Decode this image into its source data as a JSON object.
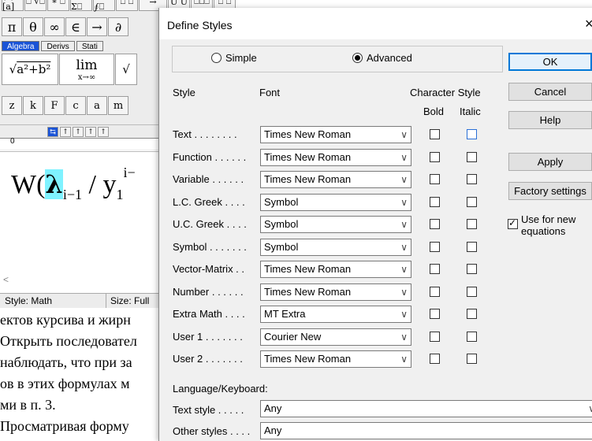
{
  "background": {
    "toolbar_row1": [
      "(a) [a]",
      "⎕ √⎕",
      "∗ ⎕",
      "Σ⎕ Σ⎕",
      "∫⎕ ∮⎕",
      "⎕ ⎕",
      "→",
      "Ū Ů",
      "⎕⎕⎕",
      "⎕ ⎕"
    ],
    "toolbar_row2": [
      "π",
      "θ",
      "∞",
      "∈",
      "→",
      "∂"
    ],
    "tabs": [
      "Algebra",
      "Derivs",
      "Stati"
    ],
    "toolbar_row4": [
      "z",
      "k",
      "F",
      "c",
      "a",
      "m"
    ],
    "tab_stops": [
      "↹",
      "↑",
      "↑",
      "↑",
      "↑"
    ],
    "ruler_zero": "0",
    "equation": {
      "W": "W(",
      "lambda": "λ",
      "sub": "i−1",
      "slash": " / ",
      "y": "y",
      "y_sub": "1",
      "sup": "i−"
    },
    "status_style": "Style: Math",
    "status_size": "Size: Full",
    "doc_lines": [
      "ектов курсива и жирн",
      "Открыть последовател",
      "наблюдать, что при за",
      "ов в этих формулах м",
      "ми в п. 3.",
      "Просматривая форму"
    ]
  },
  "dialog": {
    "title": "Define Styles",
    "close": "×",
    "mode_simple": "Simple",
    "mode_advanced": "Advanced",
    "col_style": "Style",
    "col_font": "Font",
    "col_charstyle": "Character Style",
    "col_bold": "Bold",
    "col_italic": "Italic",
    "rows": [
      {
        "style": "Text . . . . . . . .",
        "font": "Times New Roman",
        "bold": false,
        "italic": false
      },
      {
        "style": "Function . . . . . .",
        "font": "Times New Roman",
        "bold": false,
        "italic": false
      },
      {
        "style": "Variable . . . . . .",
        "font": "Times New Roman",
        "bold": false,
        "italic": false
      },
      {
        "style": "L.C. Greek . . . .",
        "font": "Symbol",
        "bold": false,
        "italic": false
      },
      {
        "style": "U.C. Greek . . . .",
        "font": "Symbol",
        "bold": false,
        "italic": false
      },
      {
        "style": "Symbol . . . . . . .",
        "font": "Symbol",
        "bold": false,
        "italic": false
      },
      {
        "style": "Vector-Matrix . .",
        "font": "Times New Roman",
        "bold": false,
        "italic": false
      },
      {
        "style": "Number . . . . . .",
        "font": "Times New Roman",
        "bold": false,
        "italic": false
      },
      {
        "style": "Extra Math . . . .",
        "font": "MT Extra",
        "bold": false,
        "italic": false
      },
      {
        "style": "User 1 . . . . . . .",
        "font": "Courier New",
        "bold": false,
        "italic": false
      },
      {
        "style": "User 2 . . . . . . .",
        "font": "Times New Roman",
        "bold": false,
        "italic": false
      }
    ],
    "language_label": "Language/Keyboard:",
    "text_style_label": "Text style . . . . .",
    "text_style_value": "Any",
    "other_styles_label": "Other styles . . . .",
    "other_styles_value": "Any",
    "buttons": {
      "ok": "OK",
      "cancel": "Cancel",
      "help": "Help",
      "apply": "Apply",
      "factory": "Factory settings"
    },
    "use_new_equations": "Use for new equations",
    "use_new_equations_checked": true
  }
}
